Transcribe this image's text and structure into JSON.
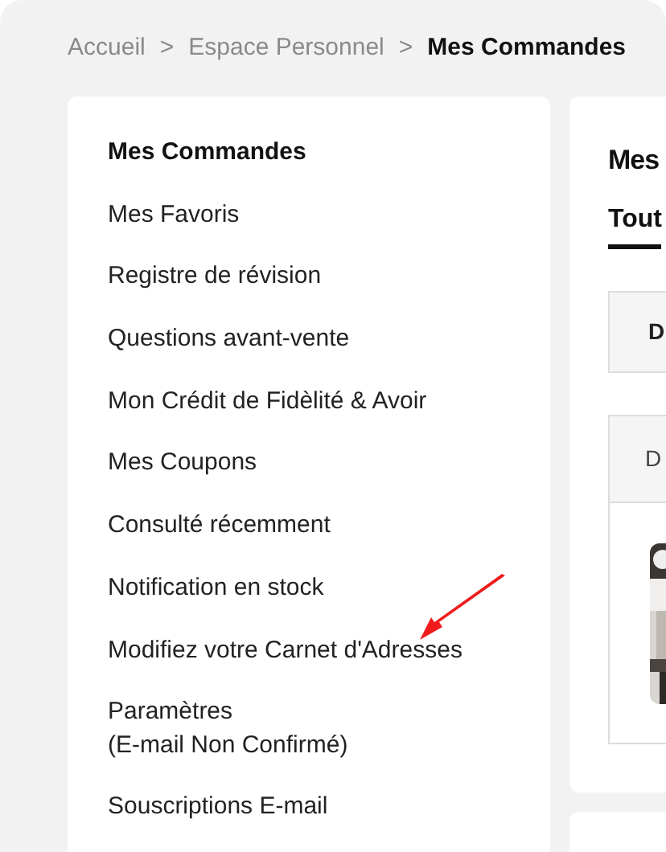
{
  "breadcrumb": [
    {
      "label": "Accueil",
      "current": false
    },
    {
      "label": "Espace Personnel",
      "current": false
    },
    {
      "label": "Mes Commandes",
      "current": true
    }
  ],
  "breadcrumb_separator": ">",
  "sidebar": {
    "items": [
      {
        "label": "Mes Commandes",
        "selected": true
      },
      {
        "label": "Mes Favoris",
        "selected": false
      },
      {
        "label": "Registre de révision",
        "selected": false
      },
      {
        "label": "Questions avant-vente",
        "selected": false
      },
      {
        "label": "Mon Crédit de Fidèlité & Avoir",
        "selected": false
      },
      {
        "label": "Mes Coupons",
        "selected": false
      },
      {
        "label": "Consulté récemment",
        "selected": false
      },
      {
        "label": "Notification en stock",
        "selected": false
      },
      {
        "label": "Modifiez votre Carnet d'Adresses",
        "selected": false
      },
      {
        "label": "Paramètres",
        "sublabel": "(E-mail Non Confirmé)",
        "selected": false
      },
      {
        "label": "Souscriptions E-mail",
        "selected": false
      }
    ]
  },
  "main": {
    "title": "Mes",
    "tabs": [
      {
        "label": "Tout",
        "selected": true
      }
    ],
    "filter_box": {
      "label": "D"
    },
    "order_card": {
      "header": "D"
    }
  }
}
